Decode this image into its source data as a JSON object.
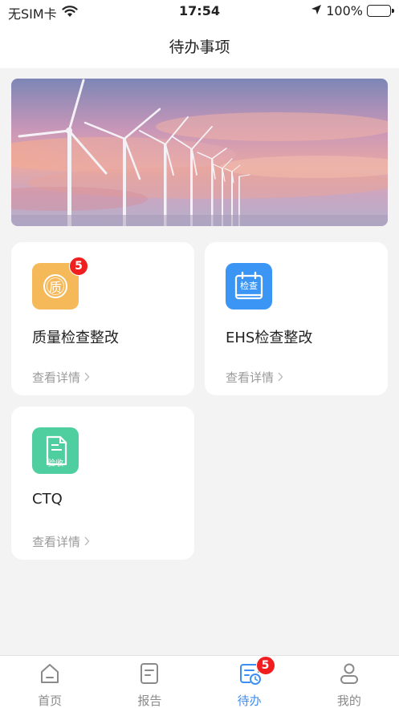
{
  "status_bar": {
    "carrier": "无SIM卡",
    "time": "17:54",
    "battery": "100%"
  },
  "header": {
    "title": "待办事项"
  },
  "cards": [
    {
      "title": "质量检查整改",
      "link": "查看详情",
      "icon_text": "质",
      "badge": "5",
      "icon_color": "#f6b95a"
    },
    {
      "title": "EHS检查整改",
      "link": "查看详情",
      "icon_text": "检查",
      "icon_color": "#3b95f5"
    },
    {
      "title": "CTQ",
      "link": "查看详情",
      "icon_text": "验收",
      "icon_color": "#4fcf9f"
    }
  ],
  "tab_bar": {
    "items": [
      {
        "label": "首页",
        "icon": "home-icon"
      },
      {
        "label": "报告",
        "icon": "report-icon"
      },
      {
        "label": "待办",
        "icon": "todo-icon",
        "badge": "5",
        "active": true
      },
      {
        "label": "我的",
        "icon": "profile-icon"
      }
    ],
    "active_color": "#3c8ff2"
  }
}
